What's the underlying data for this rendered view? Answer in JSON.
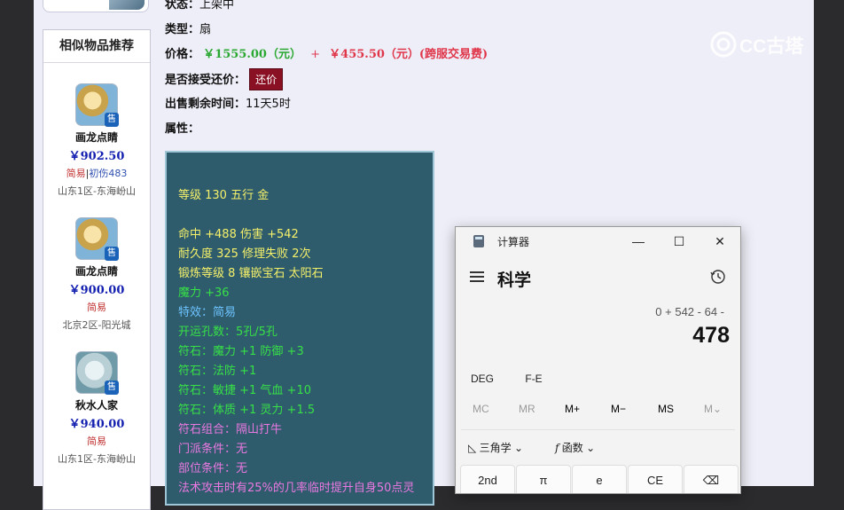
{
  "sidebar": {
    "title": "相似物品推荐",
    "items": [
      {
        "name": "画龙点睛",
        "price": "￥902.50",
        "tag": "简易",
        "tag_sep": "|",
        "tag_extra": "初伤483",
        "server": "山东1区-东海岎山",
        "badge": "售"
      },
      {
        "name": "画龙点睛",
        "price": "￥900.00",
        "tag": "简易",
        "server": "北京2区-阳光城",
        "badge": "售"
      },
      {
        "name": "秋水人家",
        "price": "￥940.00",
        "tag": "简易",
        "server": "山东1区-东海岎山",
        "badge": "售"
      }
    ]
  },
  "info": {
    "status_label": "状态：",
    "status_value": "上架中",
    "type_label": "类型：",
    "type_value": "扇",
    "price_label": "价格：",
    "price_main": "￥1555.00（元）",
    "price_plus": "+",
    "price_fee": "￥455.50（元）(跨服交易费)",
    "counter_label": "是否接受还价：",
    "counter_button": "还价",
    "remain_label": "出售剩余时间：",
    "remain_value": "11天5时",
    "attr_label": "属性："
  },
  "attributes": [
    {
      "text": "等级 130 五行 金",
      "color": "yellow"
    },
    {
      "text": "",
      "color": "yellow"
    },
    {
      "text": "命中 +488 伤害 +542",
      "color": "yellow"
    },
    {
      "text": "耐久度 325 修理失败 2次",
      "color": "yellow"
    },
    {
      "text": "锻炼等级 8 镶嵌宝石 太阳石",
      "color": "yellow"
    },
    {
      "text": "魔力 +36",
      "color": "green"
    },
    {
      "text": "特效：简易",
      "color": "blue"
    },
    {
      "text": "开运孔数：5孔/5孔",
      "color": "green"
    },
    {
      "text": "符石：魔力 +1 防御 +3",
      "color": "green"
    },
    {
      "text": "符石：法防 +1",
      "color": "green"
    },
    {
      "text": "符石：敏捷 +1 气血 +10",
      "color": "green"
    },
    {
      "text": "符石：体质 +1 灵力 +1.5",
      "color": "green"
    },
    {
      "text": "符石组合：隔山打牛",
      "color": "pink"
    },
    {
      "text": "门派条件：无",
      "color": "pink"
    },
    {
      "text": "部位条件：无",
      "color": "pink"
    },
    {
      "text": "法术攻击时有25%的几率临时提升自身50点灵",
      "color": "pink"
    }
  ],
  "watermark": {
    "text": "CC古塔"
  },
  "calculator": {
    "app_title": "计算器",
    "mode": "科学",
    "expression": "0 + 542 - 64 -",
    "result": "478",
    "angle_unit": "DEG",
    "fe": "F-E",
    "memory": [
      "MC",
      "MR",
      "M+",
      "M−",
      "MS",
      "M⌄"
    ],
    "trig_label": "三角学",
    "func_label": "函数",
    "keys": [
      "2nd",
      "π",
      "e",
      "CE",
      "⌫"
    ]
  }
}
